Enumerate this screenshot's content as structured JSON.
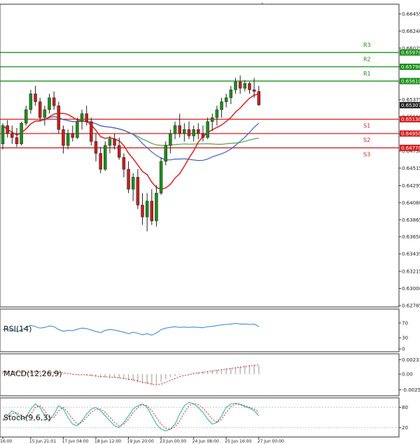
{
  "chart_data": {
    "type": "candlestick",
    "price_axis": {
      "ticks": [
        "0.66455",
        "0.66240",
        "0.66025",
        "0.65790",
        "0.65590",
        "0.65375",
        "0.65160",
        "0.64945",
        "0.64730",
        "0.64515",
        "0.64295",
        "0.64080",
        "0.63865",
        "0.63650",
        "0.63435",
        "0.63215",
        "0.63000",
        "0.62785"
      ],
      "tick_values": [
        0.66455,
        0.6624,
        0.66025,
        0.6579,
        0.6559,
        0.65375,
        0.6516,
        0.64945,
        0.6473,
        0.64515,
        0.64295,
        0.6408,
        0.63865,
        0.6365,
        0.63435,
        0.63215,
        0.63,
        0.62785
      ],
      "ylim": [
        0.62785,
        0.6656
      ]
    },
    "current_price": {
      "label": "0.65307",
      "value": 0.65307
    },
    "levels": [
      {
        "name": "R3",
        "label": "0.65970",
        "value": 0.6597,
        "color": "#1a8f1a"
      },
      {
        "name": "R2",
        "label": "0.65790",
        "value": 0.6579,
        "color": "#1a8f1a"
      },
      {
        "name": "R1",
        "label": "0.65610",
        "value": 0.6561,
        "color": "#1a8f1a"
      },
      {
        "name": "S1",
        "label": "0.65130",
        "value": 0.6513,
        "color": "#d42020"
      },
      {
        "name": "S2",
        "label": "0.64950",
        "value": 0.6495,
        "color": "#d42020"
      },
      {
        "name": "S3",
        "label": "0.64770",
        "value": 0.6477,
        "color": "#d42020"
      }
    ],
    "time_labels": [
      "16:00",
      "15 Jun 21:01",
      "17 Jun 04:00",
      "18 Jun 12:00",
      "19 Jun 20:00",
      "23 Jun 00:00",
      "24 Jun 08:00",
      "25 Jun 16:00",
      "27 Jun 00:00"
    ],
    "time_label_index": [
      0,
      6,
      13,
      20,
      27,
      34,
      41,
      48,
      55
    ],
    "candles": [
      {
        "o": 0.6482,
        "h": 0.6508,
        "l": 0.6475,
        "c": 0.6505
      },
      {
        "o": 0.6505,
        "h": 0.6512,
        "l": 0.649,
        "c": 0.6495
      },
      {
        "o": 0.6495,
        "h": 0.6505,
        "l": 0.6482,
        "c": 0.649
      },
      {
        "o": 0.649,
        "h": 0.6502,
        "l": 0.6478,
        "c": 0.6482
      },
      {
        "o": 0.6482,
        "h": 0.651,
        "l": 0.648,
        "c": 0.6508
      },
      {
        "o": 0.6508,
        "h": 0.653,
        "l": 0.6505,
        "c": 0.6525
      },
      {
        "o": 0.6525,
        "h": 0.655,
        "l": 0.652,
        "c": 0.6545
      },
      {
        "o": 0.6545,
        "h": 0.6555,
        "l": 0.653,
        "c": 0.6535
      },
      {
        "o": 0.6535,
        "h": 0.654,
        "l": 0.651,
        "c": 0.6515
      },
      {
        "o": 0.6515,
        "h": 0.653,
        "l": 0.6505,
        "c": 0.6525
      },
      {
        "o": 0.6525,
        "h": 0.6545,
        "l": 0.652,
        "c": 0.654
      },
      {
        "o": 0.654,
        "h": 0.6548,
        "l": 0.6525,
        "c": 0.653
      },
      {
        "o": 0.653,
        "h": 0.6535,
        "l": 0.6495,
        "c": 0.65
      },
      {
        "o": 0.65,
        "h": 0.6505,
        "l": 0.647,
        "c": 0.648
      },
      {
        "o": 0.648,
        "h": 0.65,
        "l": 0.6475,
        "c": 0.6495
      },
      {
        "o": 0.6495,
        "h": 0.6505,
        "l": 0.6485,
        "c": 0.649
      },
      {
        "o": 0.649,
        "h": 0.6515,
        "l": 0.6488,
        "c": 0.651
      },
      {
        "o": 0.651,
        "h": 0.6525,
        "l": 0.65,
        "c": 0.652
      },
      {
        "o": 0.652,
        "h": 0.653,
        "l": 0.6505,
        "c": 0.651
      },
      {
        "o": 0.651,
        "h": 0.6515,
        "l": 0.648,
        "c": 0.6485
      },
      {
        "o": 0.6485,
        "h": 0.6495,
        "l": 0.646,
        "c": 0.647
      },
      {
        "o": 0.647,
        "h": 0.6478,
        "l": 0.6445,
        "c": 0.645
      },
      {
        "o": 0.645,
        "h": 0.6485,
        "l": 0.6448,
        "c": 0.648
      },
      {
        "o": 0.648,
        "h": 0.6492,
        "l": 0.647,
        "c": 0.6488
      },
      {
        "o": 0.6488,
        "h": 0.6495,
        "l": 0.6475,
        "c": 0.648
      },
      {
        "o": 0.648,
        "h": 0.649,
        "l": 0.6462,
        "c": 0.6465
      },
      {
        "o": 0.6465,
        "h": 0.647,
        "l": 0.644,
        "c": 0.645
      },
      {
        "o": 0.645,
        "h": 0.646,
        "l": 0.642,
        "c": 0.6425
      },
      {
        "o": 0.6425,
        "h": 0.6445,
        "l": 0.641,
        "c": 0.644
      },
      {
        "o": 0.644,
        "h": 0.645,
        "l": 0.64,
        "c": 0.6405
      },
      {
        "o": 0.6405,
        "h": 0.642,
        "l": 0.638,
        "c": 0.639
      },
      {
        "o": 0.639,
        "h": 0.642,
        "l": 0.6372,
        "c": 0.641
      },
      {
        "o": 0.641,
        "h": 0.6425,
        "l": 0.638,
        "c": 0.6385
      },
      {
        "o": 0.6385,
        "h": 0.643,
        "l": 0.6378,
        "c": 0.642
      },
      {
        "o": 0.642,
        "h": 0.6465,
        "l": 0.6418,
        "c": 0.646
      },
      {
        "o": 0.646,
        "h": 0.6485,
        "l": 0.6455,
        "c": 0.648
      },
      {
        "o": 0.648,
        "h": 0.65,
        "l": 0.647,
        "c": 0.6495
      },
      {
        "o": 0.6495,
        "h": 0.651,
        "l": 0.6488,
        "c": 0.6505
      },
      {
        "o": 0.6505,
        "h": 0.652,
        "l": 0.649,
        "c": 0.6495
      },
      {
        "o": 0.6495,
        "h": 0.6508,
        "l": 0.6485,
        "c": 0.65
      },
      {
        "o": 0.65,
        "h": 0.651,
        "l": 0.6488,
        "c": 0.6492
      },
      {
        "o": 0.6492,
        "h": 0.6505,
        "l": 0.6485,
        "c": 0.65
      },
      {
        "o": 0.65,
        "h": 0.6508,
        "l": 0.6488,
        "c": 0.6495
      },
      {
        "o": 0.6495,
        "h": 0.6505,
        "l": 0.6485,
        "c": 0.649
      },
      {
        "o": 0.649,
        "h": 0.6515,
        "l": 0.6488,
        "c": 0.651
      },
      {
        "o": 0.651,
        "h": 0.652,
        "l": 0.6498,
        "c": 0.6515
      },
      {
        "o": 0.6515,
        "h": 0.653,
        "l": 0.6505,
        "c": 0.6525
      },
      {
        "o": 0.6525,
        "h": 0.654,
        "l": 0.6515,
        "c": 0.6535
      },
      {
        "o": 0.6535,
        "h": 0.6545,
        "l": 0.6528,
        "c": 0.654
      },
      {
        "o": 0.654,
        "h": 0.6555,
        "l": 0.6532,
        "c": 0.655
      },
      {
        "o": 0.655,
        "h": 0.6565,
        "l": 0.6545,
        "c": 0.656
      },
      {
        "o": 0.656,
        "h": 0.6568,
        "l": 0.6545,
        "c": 0.6552
      },
      {
        "o": 0.6552,
        "h": 0.6562,
        "l": 0.6548,
        "c": 0.6558
      },
      {
        "o": 0.6558,
        "h": 0.656,
        "l": 0.6545,
        "c": 0.655
      },
      {
        "o": 0.655,
        "h": 0.6565,
        "l": 0.654,
        "c": 0.6548
      },
      {
        "o": 0.6548,
        "h": 0.6555,
        "l": 0.653,
        "c": 0.6531
      }
    ],
    "indicators": [
      {
        "name": "RSI(14)",
        "ticks": [
          "70",
          "30",
          "0"
        ],
        "tick_values": [
          70,
          30,
          0
        ],
        "ylim": [
          0,
          100
        ],
        "color": "#2f7fd8",
        "values": [
          52,
          54,
          50,
          47,
          51,
          58,
          64,
          60,
          56,
          58,
          62,
          60,
          52,
          48,
          50,
          49,
          53,
          56,
          55,
          51,
          47,
          44,
          50,
          52,
          51,
          48,
          45,
          41,
          45,
          42,
          38,
          41,
          37,
          43,
          52,
          56,
          58,
          60,
          58,
          59,
          58,
          59,
          58,
          57,
          60,
          61,
          63,
          65,
          66,
          67,
          69,
          67,
          67,
          66,
          67,
          60
        ]
      },
      {
        "name": "MACD(12,26,9)",
        "ticks": [
          "0.00231",
          "0.00",
          "-0.00250"
        ],
        "tick_values": [
          0.00231,
          0.0,
          -0.0025
        ],
        "ylim": [
          -0.003,
          0.0028
        ],
        "bar_color": "#b8b8b8",
        "signal_color": "#d42020",
        "histogram": [
          0.0004,
          0.0004,
          0.0003,
          0.0002,
          0.0002,
          0.0003,
          0.0004,
          0.0004,
          0.0003,
          0.0003,
          0.0003,
          0.0003,
          0.0002,
          0.0001,
          0.0,
          -0.0001,
          -0.0001,
          -0.0001,
          -0.0002,
          -0.0003,
          -0.0004,
          -0.0005,
          -0.0005,
          -0.0005,
          -0.0006,
          -0.0007,
          -0.0008,
          -0.001,
          -0.0011,
          -0.0013,
          -0.0015,
          -0.0016,
          -0.0017,
          -0.0016,
          -0.0012,
          -0.0008,
          -0.0005,
          -0.0003,
          -0.0001,
          0.0,
          0.0001,
          0.0002,
          0.0003,
          0.0004,
          0.0005,
          0.0006,
          0.0007,
          0.0008,
          0.0009,
          0.001,
          0.0011,
          0.0012,
          0.0013,
          0.0014,
          0.0015,
          0.0014
        ],
        "signal": [
          0.0004,
          0.0004,
          0.0004,
          0.0003,
          0.0003,
          0.0003,
          0.0003,
          0.0004,
          0.0004,
          0.0003,
          0.0003,
          0.0003,
          0.0003,
          0.0002,
          0.0001,
          0.0,
          -0.0001,
          -0.0001,
          -0.0001,
          -0.0002,
          -0.0003,
          -0.0004,
          -0.0004,
          -0.0005,
          -0.0005,
          -0.0006,
          -0.0007,
          -0.0008,
          -0.0009,
          -0.0011,
          -0.0013,
          -0.0014,
          -0.0016,
          -0.0017,
          -0.0016,
          -0.0013,
          -0.001,
          -0.0007,
          -0.0004,
          -0.0002,
          -0.0001,
          0.0001,
          0.0002,
          0.0003,
          0.0004,
          0.0005,
          0.0006,
          0.0007,
          0.0008,
          0.0009,
          0.001,
          0.0011,
          0.0012,
          0.0013,
          0.0014,
          0.0015
        ]
      },
      {
        "name": "Stoch(9,6,3)",
        "ticks": [
          "80",
          "20"
        ],
        "tick_values": [
          80,
          20
        ],
        "ylim": [
          0,
          100
        ],
        "main_color": "#20b2aa",
        "signal_color": "#d42020",
        "main": [
          40,
          55,
          70,
          60,
          45,
          50,
          75,
          90,
          80,
          55,
          40,
          60,
          85,
          75,
          50,
          30,
          25,
          40,
          60,
          75,
          80,
          70,
          55,
          40,
          25,
          20,
          35,
          55,
          75,
          85,
          90,
          80,
          55,
          30,
          15,
          10,
          15,
          30,
          60,
          85,
          95,
          90,
          80,
          65,
          45,
          30,
          35,
          55,
          80,
          90,
          92,
          88,
          82,
          78,
          70,
          55
        ],
        "signal": [
          45,
          50,
          60,
          65,
          55,
          50,
          60,
          80,
          85,
          70,
          50,
          50,
          70,
          80,
          65,
          45,
          30,
          35,
          50,
          65,
          75,
          75,
          65,
          50,
          35,
          25,
          30,
          45,
          65,
          80,
          88,
          85,
          70,
          50,
          30,
          18,
          15,
          22,
          40,
          65,
          85,
          92,
          88,
          78,
          62,
          45,
          35,
          45,
          65,
          82,
          90,
          90,
          85,
          80,
          75,
          65
        ]
      }
    ]
  }
}
